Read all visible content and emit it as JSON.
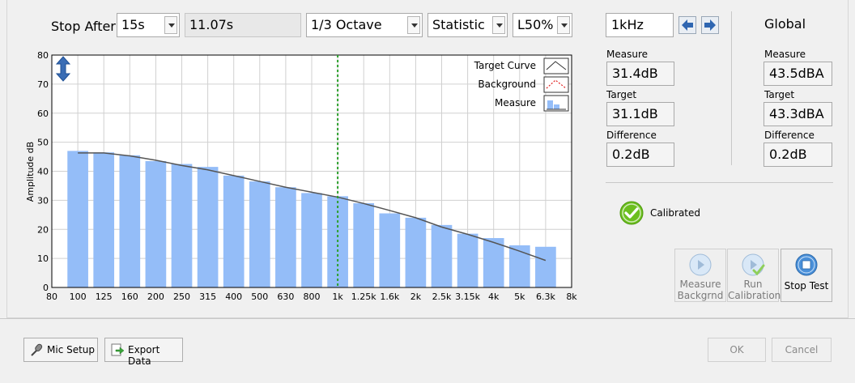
{
  "toolbar": {
    "stop_after_label": "Stop After",
    "stop_after_value": "15s",
    "elapsed": "11.07s",
    "band_value": "1/3 Octave",
    "mode_value": "Statistic",
    "stat_value": "L50%"
  },
  "frequency": {
    "value": "1kHz"
  },
  "band_panel": {
    "measure_label": "Measure",
    "measure_value": "31.4dB",
    "target_label": "Target",
    "target_value": "31.1dB",
    "difference_label": "Difference",
    "difference_value": "0.2dB"
  },
  "global_panel": {
    "title": "Global",
    "measure_label": "Measure",
    "measure_value": "43.5dBA",
    "target_label": "Target",
    "target_value": "43.3dBA",
    "difference_label": "Difference",
    "difference_value": "0.2dB"
  },
  "status": {
    "calibrated_label": "Calibrated",
    "ok_color": "#6cbf1f"
  },
  "actions": {
    "measure_bg_line1": "Measure",
    "measure_bg_line2": "Backgrnd",
    "run_cal_line1": "Run",
    "run_cal_line2": "Calibration",
    "stop_test": "Stop Test"
  },
  "footer": {
    "mic_setup": "Mic Setup",
    "export_data": "Export Data",
    "ok": "OK",
    "cancel": "Cancel"
  },
  "chart_data": {
    "type": "bar",
    "ylabel": "Amplitude dB",
    "ylim": [
      0,
      80
    ],
    "yticks": [
      0,
      10,
      20,
      30,
      40,
      50,
      60,
      70,
      80
    ],
    "x_tick_labels": [
      "80",
      "100",
      "125",
      "160",
      "200",
      "250",
      "315",
      "400",
      "500",
      "630",
      "800",
      "1k",
      "1.25k",
      "1.6k",
      "2k",
      "2.5k",
      "3.15k",
      "4k",
      "5k",
      "6.3k",
      "8k"
    ],
    "categories": [
      "100",
      "125",
      "160",
      "200",
      "250",
      "315",
      "400",
      "500",
      "630",
      "800",
      "1k",
      "1.25k",
      "1.6k",
      "2k",
      "2.5k",
      "3.15k",
      "4k",
      "5k",
      "6.3k"
    ],
    "grid": true,
    "legend_position": "top-right",
    "marker_frequency": "1k",
    "series": [
      {
        "name": "Measure",
        "kind": "bar",
        "color": "#94bdf8",
        "values": [
          47,
          46.5,
          45.5,
          43.5,
          42.5,
          41.5,
          38.5,
          36.5,
          34.5,
          32.5,
          31.4,
          29,
          25.5,
          24,
          21.5,
          18.5,
          17,
          14.5,
          14
        ]
      },
      {
        "name": "Target Curve",
        "kind": "line",
        "color": "#555555",
        "values": [
          46.3,
          46.3,
          45.3,
          43.8,
          42,
          40.5,
          38.5,
          36.5,
          34.5,
          32.8,
          31.1,
          28.9,
          26.5,
          24,
          20.8,
          18.3,
          15.5,
          12.5,
          9.3
        ]
      },
      {
        "name": "Background",
        "kind": "line",
        "color": "#e02020",
        "values": []
      }
    ]
  }
}
